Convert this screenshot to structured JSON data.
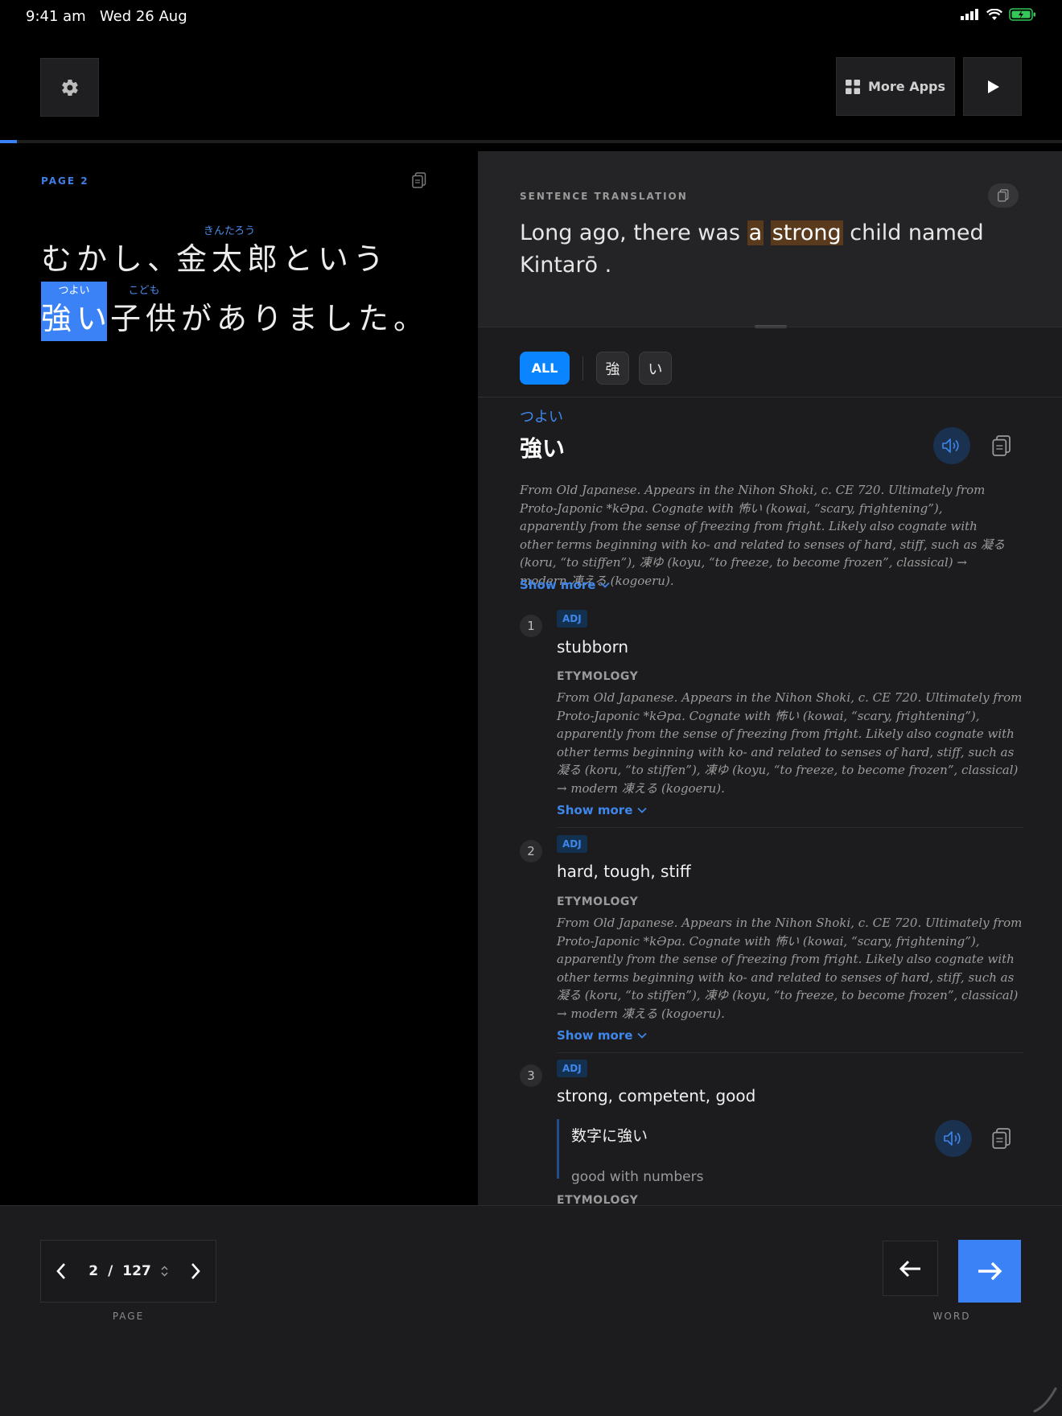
{
  "status": {
    "time": "9:41 am",
    "date": "Wed 26 Aug"
  },
  "header": {
    "more_apps_label": "More Apps",
    "progress": 0.016
  },
  "reader": {
    "page_label": "PAGE  2",
    "line1": [
      {
        "text": "むかし、",
        "ruby": ""
      },
      {
        "text": "金太郎",
        "ruby": "きんたろう"
      },
      {
        "text": "という",
        "ruby": ""
      }
    ],
    "line2": [
      {
        "text": "強い",
        "ruby": "つよい",
        "highlight": true
      },
      {
        "text": "子供",
        "ruby": "こども"
      },
      {
        "text": "がありました。",
        "ruby": ""
      }
    ]
  },
  "translation": {
    "label": "SENTENCE TRANSLATION",
    "parts": [
      "Long ago",
      ", there was ",
      "a",
      " ",
      "strong",
      " child named Kintarō",
      " ."
    ]
  },
  "filters": {
    "all": "ALL",
    "chars": [
      "強",
      "い"
    ]
  },
  "word": {
    "reading": "つよい",
    "title": "強い",
    "etymology": "From Old Japanese. Appears in the Nihon Shoki, c. CE 720. Ultimately from Proto-Japonic *kƏpa. Cognate with 怖い (kowai, “scary, frightening”), apparently from the sense of freezing from fright. Likely also cognate with other terms beginning with ko- and related to senses of hard, stiff, such as 凝る (koru, “to stiffen”), 凍ゆ (koyu, “to freeze, to become frozen”, classical) → modern 凍える (kogoeru).",
    "show_more": "Show more"
  },
  "senses": [
    {
      "num": "1",
      "pos": "ADJ",
      "gloss": "stubborn",
      "ety_label": "ETYMOLOGY",
      "etymology": "From Old Japanese. Appears in the Nihon Shoki, c. CE 720. Ultimately from Proto-Japonic *kƏpa. Cognate with 怖い (kowai, “scary, frightening”), apparently from the sense of freezing from fright. Likely also cognate with other terms beginning with ko- and related to senses of hard, stiff, such as 凝る (koru, “to stiffen”), 凍ゆ (koyu, “to freeze, to become frozen”, classical) → modern 凍える (kogoeru).",
      "show_more": "Show more"
    },
    {
      "num": "2",
      "pos": "ADJ",
      "gloss": "hard, tough, stiff",
      "ety_label": "ETYMOLOGY",
      "etymology": "From Old Japanese. Appears in the Nihon Shoki, c. CE 720. Ultimately from Proto-Japonic *kƏpa. Cognate with 怖い (kowai, “scary, frightening”), apparently from the sense of freezing from fright. Likely also cognate with other terms beginning with ko- and related to senses of hard, stiff, such as 凝る (koru, “to stiffen”), 凍ゆ (koyu, “to freeze, to become frozen”, classical) → modern 凍える (kogoeru).",
      "show_more": "Show more"
    },
    {
      "num": "3",
      "pos": "ADJ",
      "gloss": "strong, competent, good",
      "ety_label": "ETYMOLOGY",
      "example_jp": "数字に強い",
      "example_en": "good with numbers"
    }
  ],
  "pager": {
    "current": "2",
    "separator": "/",
    "total": "127",
    "caption": "PAGE"
  },
  "word_nav": {
    "caption": "WORD"
  },
  "colors": {
    "accent": "#3b82f6",
    "highlight_bg": "#5a3a1c",
    "link": "#3f86ea"
  }
}
